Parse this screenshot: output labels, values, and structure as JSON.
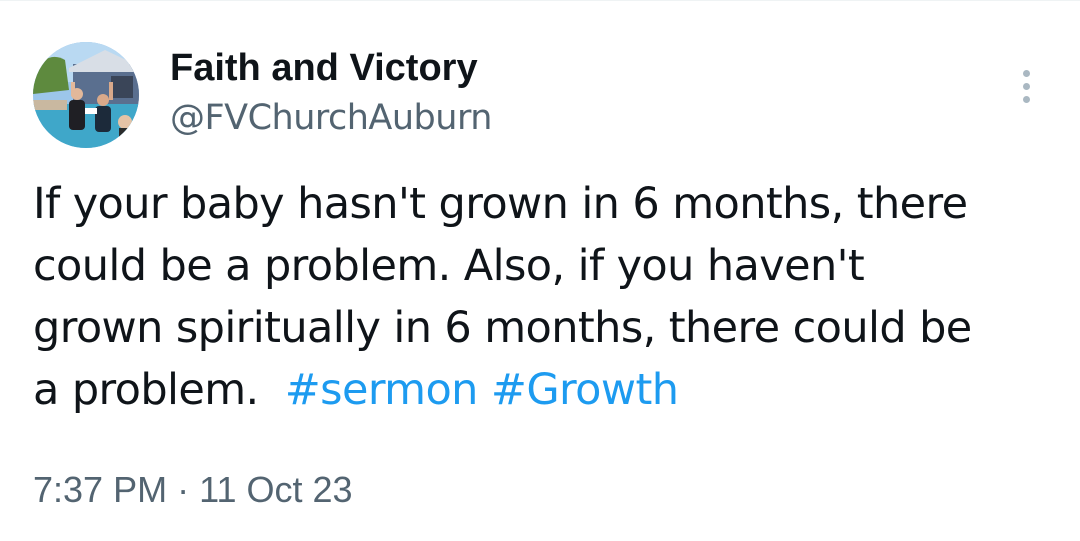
{
  "tweet": {
    "author": {
      "display_name": "Faith and Victory",
      "handle": "@FVChurchAuburn"
    },
    "text": {
      "line1": "If your baby hasn't grown in 6 months, there",
      "line2": "could be a problem.  Also, if you haven't",
      "line3": "grown spiritually in 6 months, there could be",
      "line4_plain": "a problem.  ",
      "hashtags": [
        "#sermon",
        "#Growth"
      ]
    },
    "time": "7:37 PM",
    "separator": "·",
    "date": "11 Oct 23"
  },
  "icons": {
    "more": "more-vertical-icon",
    "avatar": "avatar-photo"
  },
  "colors": {
    "text": "#0f1419",
    "secondary": "#536471",
    "hashtag": "#1d9bf0",
    "more_dots": "#aab8c2"
  }
}
